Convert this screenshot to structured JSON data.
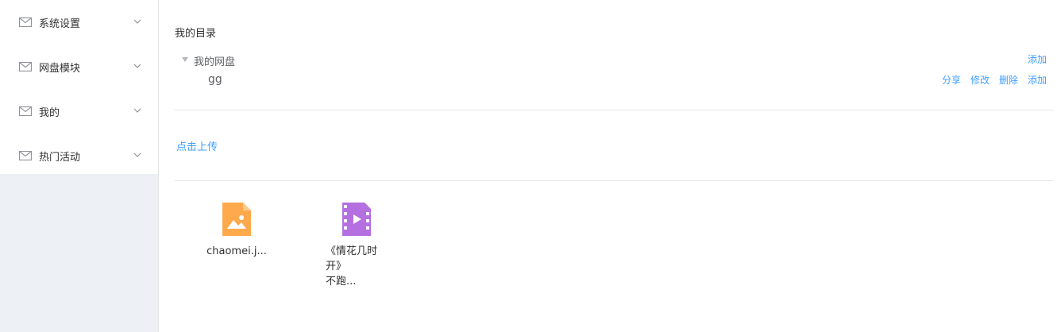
{
  "sidebar": {
    "items": [
      {
        "label": "系统设置",
        "icon": "mail-icon"
      },
      {
        "label": "网盘模块",
        "icon": "mail-icon"
      },
      {
        "label": "我的",
        "icon": "mail-icon"
      },
      {
        "label": "热门活动",
        "icon": "mail-icon"
      }
    ]
  },
  "directory": {
    "title": "我的目录",
    "root": {
      "label": "我的网盘",
      "actions": {
        "add": "添加"
      }
    },
    "child": {
      "label": "gg",
      "actions": {
        "share": "分享",
        "edit": "修改",
        "delete": "删除",
        "add": "添加"
      }
    }
  },
  "upload": {
    "label": "点击上传"
  },
  "files": [
    {
      "name": "chaomei.j...",
      "icon": "image-file-icon",
      "color": "#ffa94d"
    },
    {
      "name_line1": "《情花几时开》",
      "name_line2": "不跑...",
      "icon": "video-file-icon",
      "color": "#b46fe0"
    }
  ],
  "colors": {
    "link": "#409eff",
    "sidebar_bg": "#edf0f5"
  }
}
